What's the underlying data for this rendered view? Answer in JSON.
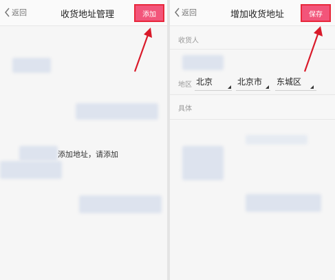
{
  "left_screen": {
    "back_label": "返回",
    "title": "收货地址管理",
    "add_label": "添加",
    "empty_message": "添加地址，请添加"
  },
  "right_screen": {
    "back_label": "返回",
    "title": "增加收货地址",
    "save_label": "保存",
    "fields": {
      "recipient_label": "收货人",
      "region_label": "地区",
      "detail_label": "具体"
    },
    "region": {
      "province": "北京",
      "city": "北京市",
      "district": "东城区"
    }
  },
  "colors": {
    "accent": "#f2557a",
    "highlight_border": "#e8273b",
    "arrow": "#d91a2a"
  }
}
